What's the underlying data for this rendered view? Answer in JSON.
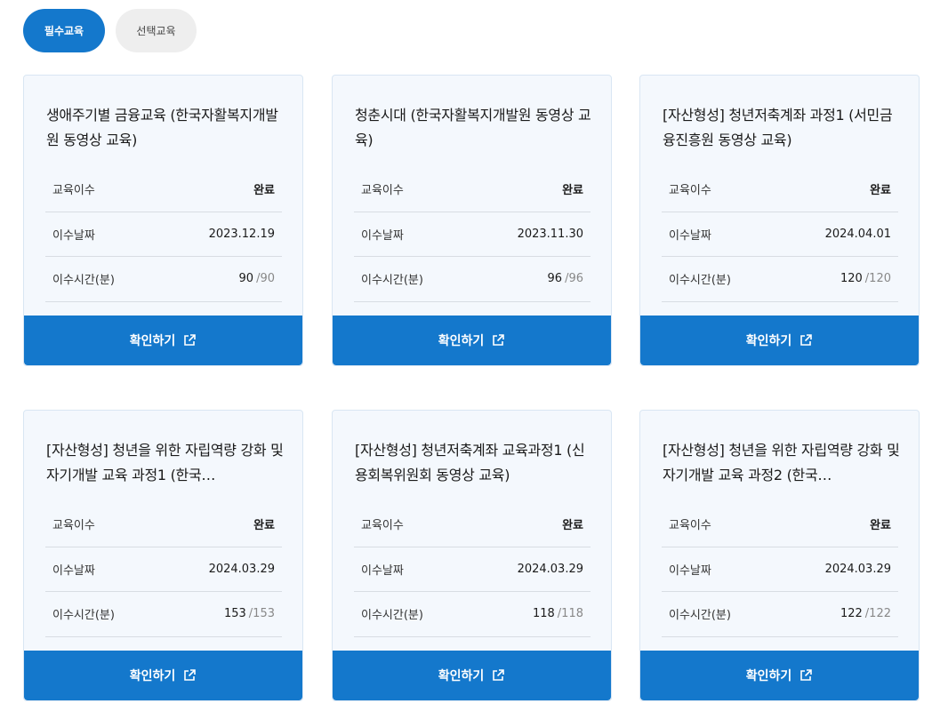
{
  "tabs": {
    "required": "필수교육",
    "elective": "선택교육"
  },
  "labels": {
    "status": "교육이수",
    "date": "이수날짜",
    "time": "이수시간(분)",
    "button": "확인하기"
  },
  "icons": {
    "button": "external-link-icon"
  },
  "colors": {
    "accent": "#1478cc",
    "card_bg": "#f4f8fd"
  },
  "cards": [
    {
      "title": "생애주기별 금융교육 (한국자활복지개발원 동영상 교육)",
      "status": "완료",
      "date": "2023.12.19",
      "time_done": "90",
      "time_total": "/90"
    },
    {
      "title": "청춘시대 (한국자활복지개발원 동영상 교육)",
      "status": "완료",
      "date": "2023.11.30",
      "time_done": "96",
      "time_total": "/96"
    },
    {
      "title": "[자산형성] 청년저축계좌 과정1 (서민금융진흥원 동영상 교육)",
      "status": "완료",
      "date": "2024.04.01",
      "time_done": "120",
      "time_total": "/120"
    },
    {
      "title": "[자산형성] 청년을 위한 자립역량 강화 및 자기개발 교육 과정1 (한국…",
      "status": "완료",
      "date": "2024.03.29",
      "time_done": "153",
      "time_total": "/153"
    },
    {
      "title": "[자산형성] 청년저축계좌 교육과정1 (신용회복위원회 동영상 교육)",
      "status": "완료",
      "date": "2024.03.29",
      "time_done": "118",
      "time_total": "/118"
    },
    {
      "title": "[자산형성] 청년을 위한 자립역량 강화 및 자기개발 교육 과정2 (한국…",
      "status": "완료",
      "date": "2024.03.29",
      "time_done": "122",
      "time_total": "/122"
    }
  ]
}
